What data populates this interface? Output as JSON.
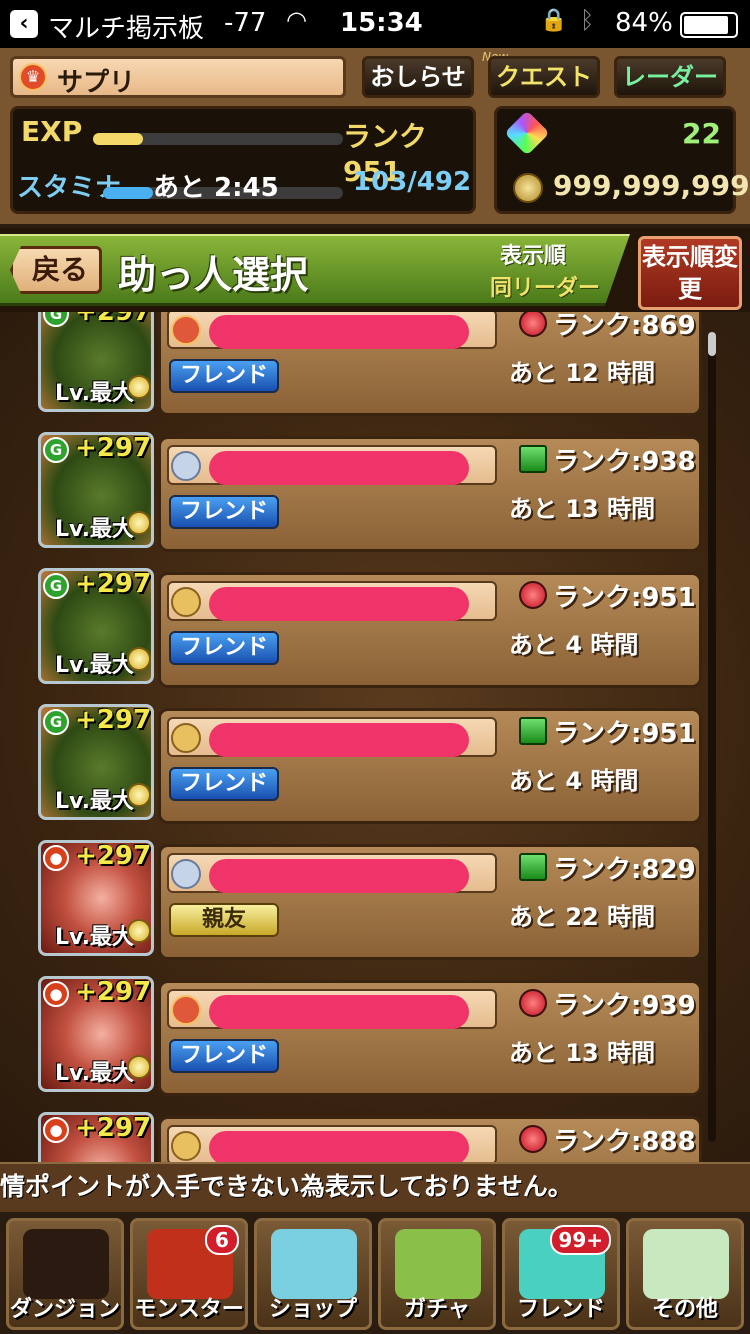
{
  "status_bar": {
    "back_app": "マルチ掲示板",
    "signal": "-77",
    "time": "15:34",
    "battery": "84%"
  },
  "player": {
    "name": "サプリ",
    "exp_label": "EXP",
    "exp_fill": 0.2,
    "rank": "ランク 951",
    "stamina_label": "スタミナ",
    "stamina_timer": "あと 2:45",
    "stamina": "103/492",
    "stamina_fill": 0.21,
    "magic_stones": "22",
    "coins": "999,999,999+"
  },
  "top_buttons": {
    "news": "おしらせ",
    "new_tag": "New",
    "quest": "クエスト",
    "radar": "レーダー"
  },
  "header": {
    "back": "戻る",
    "title": "助っ人選択",
    "sort_label": "表示順",
    "sort_value": "同リーダー",
    "sort_button": "表示順変更"
  },
  "helpers": [
    {
      "plus": "+297",
      "level": "Lv.最大",
      "portrait": "green",
      "rank_icon": "red",
      "relation": "フレンド",
      "status": "red",
      "rank": "ランク:869",
      "remaining": "あと 12 時間"
    },
    {
      "plus": "+297",
      "level": "Lv.最大",
      "portrait": "green",
      "rank_icon": "silver",
      "relation": "フレンド",
      "status": "green",
      "rank": "ランク:938",
      "remaining": "あと 13 時間"
    },
    {
      "plus": "+297",
      "level": "Lv.最大",
      "portrait": "green",
      "rank_icon": "gold",
      "relation": "フレンド",
      "status": "red",
      "rank": "ランク:951",
      "remaining": "あと 4 時間"
    },
    {
      "plus": "+297",
      "level": "Lv.最大",
      "portrait": "green",
      "rank_icon": "gold",
      "relation": "フレンド",
      "status": "green",
      "rank": "ランク:951",
      "remaining": "あと 4 時間"
    },
    {
      "plus": "+297",
      "level": "Lv.最大",
      "portrait": "red",
      "rank_icon": "silver",
      "relation": "親友",
      "status": "green",
      "rank": "ランク:829",
      "remaining": "あと 22 時間"
    },
    {
      "plus": "+297",
      "level": "Lv.最大",
      "portrait": "red",
      "rank_icon": "red",
      "relation": "フレンド",
      "status": "red",
      "rank": "ランク:939",
      "remaining": "あと 13 時間"
    },
    {
      "plus": "+297",
      "level": "",
      "portrait": "red",
      "rank_icon": "gold",
      "relation": "",
      "status": "red",
      "rank": "ランク:888",
      "remaining": ""
    }
  ],
  "message": "情ポイントが入手できない為表示しておりません。",
  "nav": [
    {
      "label": "ダンジョン",
      "badge": "",
      "color": "#2a1a10"
    },
    {
      "label": "モンスター",
      "badge": "6",
      "color": "#c0301a"
    },
    {
      "label": "ショップ",
      "badge": "",
      "color": "#7ad0e0"
    },
    {
      "label": "ガチャ",
      "badge": "",
      "color": "#8ac04a"
    },
    {
      "label": "フレンド",
      "badge": "99+",
      "color": "#4ad0c0"
    },
    {
      "label": "その他",
      "badge": "",
      "color": "#c8e8c0"
    }
  ]
}
